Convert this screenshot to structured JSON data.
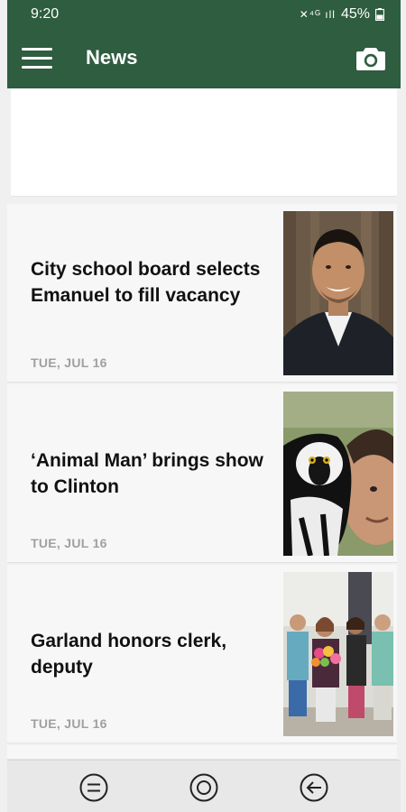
{
  "status_bar": {
    "time": "9:20",
    "icons": "✕⁴ᴳ ıll",
    "battery": "45%"
  },
  "app_bar": {
    "title": "News"
  },
  "articles": [
    {
      "title": "City school board selects Emanuel to fill vacancy",
      "date": "TUE, JUL 16",
      "thumb_icon": "portrait-photo-man"
    },
    {
      "title": "‘Animal Man’ brings show to Clinton",
      "date": "TUE, JUL 16",
      "thumb_icon": "lemur-and-man-photo"
    },
    {
      "title": "Garland honors clerk, deputy",
      "date": "TUE, JUL 16",
      "thumb_icon": "group-photo-women-flowers"
    }
  ],
  "bottom_nav": {
    "icons": [
      "recent-apps-icon",
      "home-icon",
      "back-icon"
    ]
  }
}
